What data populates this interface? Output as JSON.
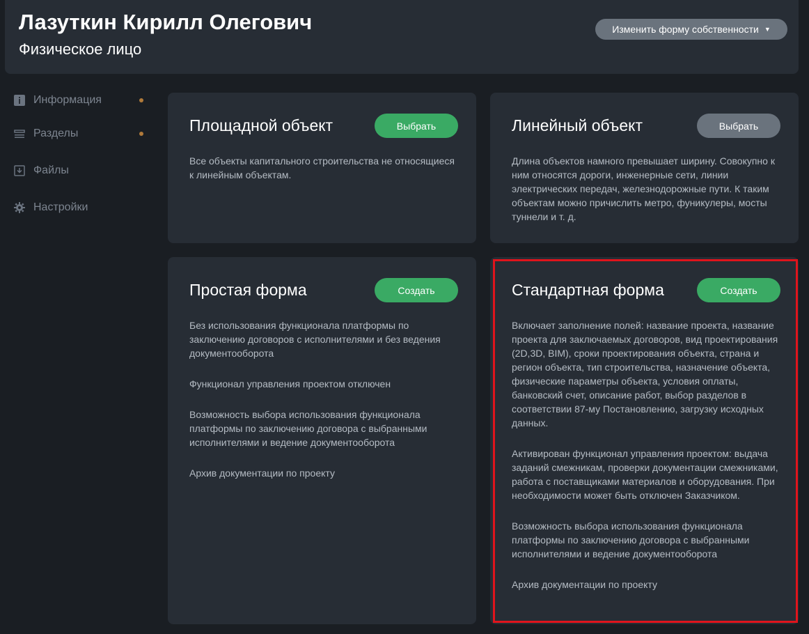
{
  "header": {
    "name": "Лазуткин Кирилл Олегович",
    "subtitle": "Физическое лицо",
    "ownership_button": "Изменить форму собственности",
    "ownership_caret": "▼"
  },
  "sidebar": {
    "items": [
      {
        "label": "Информация",
        "icon": "info-icon",
        "has_dot": true
      },
      {
        "label": "Разделы",
        "icon": "sections-icon",
        "has_dot": true
      },
      {
        "label": "Файлы",
        "icon": "download-icon",
        "has_dot": false
      },
      {
        "label": "Настройки",
        "icon": "gear-icon",
        "has_dot": false
      }
    ],
    "dot_color": "#b07a3a"
  },
  "cards": {
    "area": {
      "title": "Площадной объект",
      "button": "Выбрать",
      "paragraphs": [
        "Все объекты капитального строительства не относящиеся к линейным объектам."
      ]
    },
    "linear": {
      "title": "Линейный объект",
      "button": "Выбрать",
      "paragraphs": [
        "Длина объектов намного превышает ширину. Совокупно к ним относятся дороги, инженерные сети, линии электрических передач, железнодорожные пути. К таким объектам можно причислить метро, фуникулеры, мосты туннели и т. д."
      ]
    },
    "simple": {
      "title": "Простая форма",
      "button": "Создать",
      "paragraphs": [
        "Без использования функционала платформы по заключению договоров с исполнителями и без ведения документооборота",
        "Функционал управления проектом отключен",
        "Возможность выбора использования функционала платформы по заключению договора с выбранными исполнителями и ведение документооборота",
        "Архив документации по проекту"
      ]
    },
    "standard": {
      "title": "Стандартная форма",
      "button": "Создать",
      "paragraphs": [
        "Включает заполнение полей: название проекта, название проекта для заключаемых договоров, вид проектирования (2D,3D, BIM), сроки проектирования объекта, страна и регион объекта, тип строительства, назначение объекта, физические параметры объекта, условия оплаты, банковский счет, описание работ, выбор разделов в соответствии 87-му Постановлению, загрузку исходных данных.",
        "Активирован функционал управления проектом: выдача заданий смежникам, проверки документации смежниками, работа с поставщиками материалов и оборудования. При необходимости может быть отключен Заказчиком.",
        "Возможность выбора использования функционала платформы по заключению договора с выбранными исполнителями и ведение документооборота",
        "Архив документации по проекту"
      ]
    }
  },
  "colors": {
    "background": "#1a1e23",
    "card": "#272d35",
    "accent_green": "#3aaa64",
    "button_grey": "#6a737d",
    "highlight_red": "#e0141c"
  }
}
